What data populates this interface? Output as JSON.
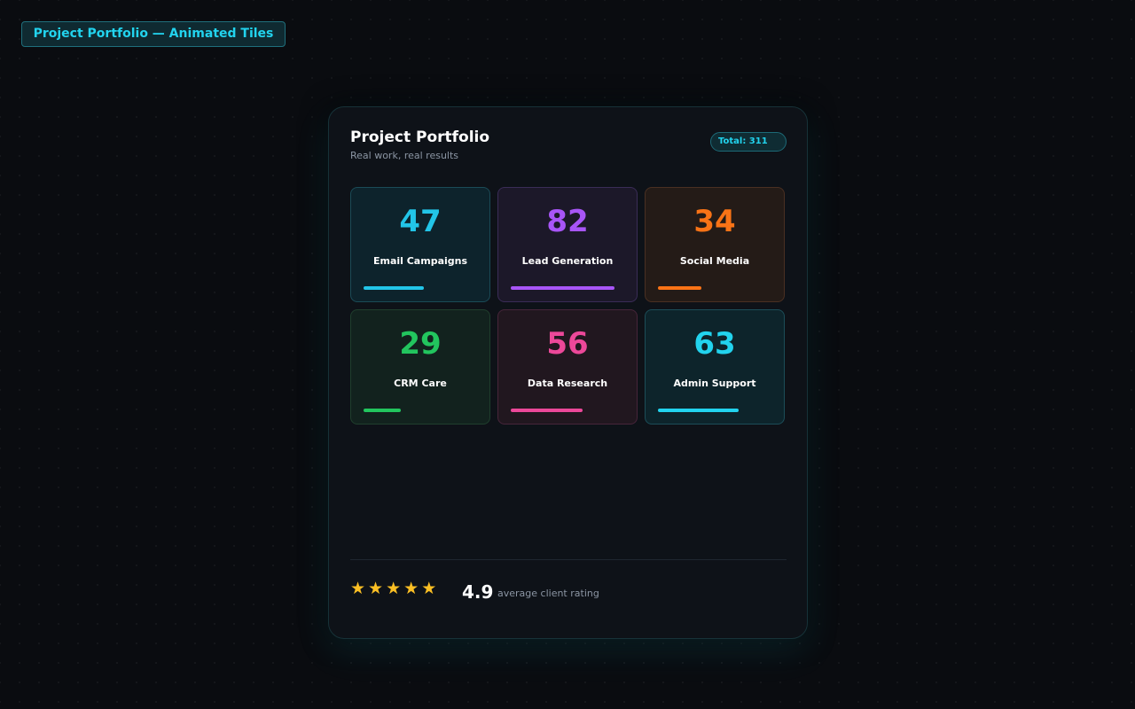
{
  "page": {
    "badge": "Project Portfolio — Animated Tiles"
  },
  "card": {
    "title": "Project Portfolio",
    "subtitle": "Real work, real results",
    "total_label": "Total: 311"
  },
  "tiles": [
    {
      "value": "47",
      "label": "Email Campaigns",
      "color": "#22c5e8",
      "bg": "#0d232c",
      "border": "#1b4b57",
      "progress": 0.52
    },
    {
      "value": "82",
      "label": "Lead Generation",
      "color": "#a855f7",
      "bg": "#1c1829",
      "border": "#3a2c57",
      "progress": 0.9
    },
    {
      "value": "34",
      "label": "Social Media",
      "color": "#f97316",
      "bg": "#241b17",
      "border": "#4a3022",
      "progress": 0.38
    },
    {
      "value": "29",
      "label": "CRM Care",
      "color": "#22c55e",
      "bg": "#12221e",
      "border": "#1f3f2d",
      "progress": 0.32
    },
    {
      "value": "56",
      "label": "Data Research",
      "color": "#ec4899",
      "bg": "#21171f",
      "border": "#47253a",
      "progress": 0.62
    },
    {
      "value": "63",
      "label": "Admin Support",
      "color": "#22d3ee",
      "bg": "#0d242b",
      "border": "#1c4d58",
      "progress": 0.7
    }
  ],
  "rating": {
    "stars": 5,
    "star_glyph": "★",
    "star_color": "#fbbf24",
    "value": "4.9",
    "caption": "average client rating"
  }
}
